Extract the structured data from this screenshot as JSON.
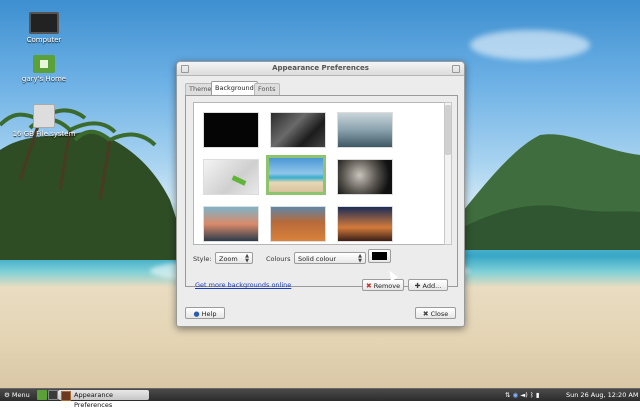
{
  "desktop": {
    "icons": [
      {
        "label": "Computer"
      },
      {
        "label": "gary's Home"
      },
      {
        "label": "16 GB File system"
      }
    ]
  },
  "dialog": {
    "title": "Appearance Preferences",
    "tabs": [
      {
        "label": "Theme",
        "active": false
      },
      {
        "label": "Background",
        "active": true
      },
      {
        "label": "Fonts",
        "active": false
      }
    ],
    "style_label": "Style:",
    "style_value": "Zoom",
    "colours_label": "Colours",
    "colours_value": "Solid colour",
    "colour_swatch": "#000000",
    "link_text": "Get more backgrounds online",
    "remove_label": "Remove",
    "add_label": "Add...",
    "help_label": "Help",
    "close_label": "Close"
  },
  "taskbar": {
    "menu_label": "Menu",
    "task_label": "Appearance Preferences",
    "clock": "Sun 26 Aug, 12:20 AM"
  }
}
